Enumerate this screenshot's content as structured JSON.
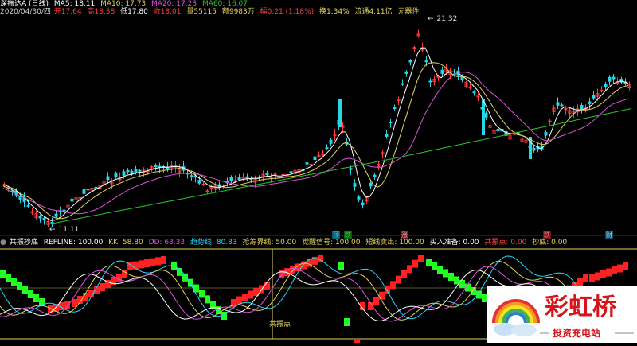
{
  "top_title": "深振达A (日线)",
  "top_ma": [
    {
      "label": "MA5: 18.11",
      "color": "#ffffff"
    },
    {
      "label": "MA10: 17.73",
      "color": "#e6d35a"
    },
    {
      "label": "MA20: 17.23",
      "color": "#d657d6"
    },
    {
      "label": "MA60: 16.07",
      "color": "#29c329"
    }
  ],
  "quote": [
    {
      "label": "2020/04/30/四",
      "color": "#cfcfcf"
    },
    {
      "label": "开17.64",
      "color": "#ff4040"
    },
    {
      "label": "高18.38",
      "color": "#ff4040"
    },
    {
      "label": "低17.80",
      "color": "#ffffff"
    },
    {
      "label": "收18.01",
      "color": "#ff4040"
    },
    {
      "label": "量55115",
      "color": "#e6d35a"
    },
    {
      "label": "额9983万",
      "color": "#e6d35a"
    },
    {
      "label": "幅0.21 (1.18%)",
      "color": "#ff4040"
    },
    {
      "label": "换1.34%",
      "color": "#e6d35a"
    },
    {
      "label": "流通4.11亿",
      "color": "#e6d35a"
    },
    {
      "label": "元器件",
      "color": "#e6d35a"
    }
  ],
  "price_high_label": "21.32",
  "price_low_label": "11.11",
  "sub_header": [
    {
      "label": "共振抄底",
      "color": "#ffffff"
    },
    {
      "label": "REFLINE: 100.00",
      "color": "#ffffff"
    },
    {
      "label": "KK: 58.80",
      "color": "#e6d35a"
    },
    {
      "label": "DD: 63.33",
      "color": "#d657d6"
    },
    {
      "label": "趋势线: 80.83",
      "color": "#25d7ff"
    },
    {
      "label": "抢筹界线: 50.00",
      "color": "#e6d35a"
    },
    {
      "label": "觉醒信号: 100.00",
      "color": "#e6d35a"
    },
    {
      "label": "短线卖出: 100.00",
      "color": "#e6d35a"
    },
    {
      "label": "买入准备: 0.00",
      "color": "#ffffff"
    },
    {
      "label": "共振点: 0.00",
      "color": "#ff4040"
    },
    {
      "label": "抄底: 0.00",
      "color": "#e6d35a"
    }
  ],
  "signal_marks": [
    {
      "label": "顶",
      "color": "#25d7ff"
    },
    {
      "label": "跌",
      "color": "#29c329"
    },
    {
      "label": "涨",
      "color": "#ff4040"
    },
    {
      "label": "跌",
      "color": "#ff4040"
    },
    {
      "label": "财",
      "color": "#25d7ff"
    }
  ],
  "resonance_label": "共振点",
  "logo_title": "彩虹桥",
  "logo_sub": "投资充电站",
  "colors": {
    "up": "#ff3c3c",
    "down": "#28d7e6",
    "ma5": "#ffffff",
    "ma10": "#e6d35a",
    "ma20": "#d657d6",
    "ma60": "#29c329",
    "trend": "#25d7ff",
    "bull_bar": "#ff2020",
    "bear_bar": "#20ff20"
  }
}
